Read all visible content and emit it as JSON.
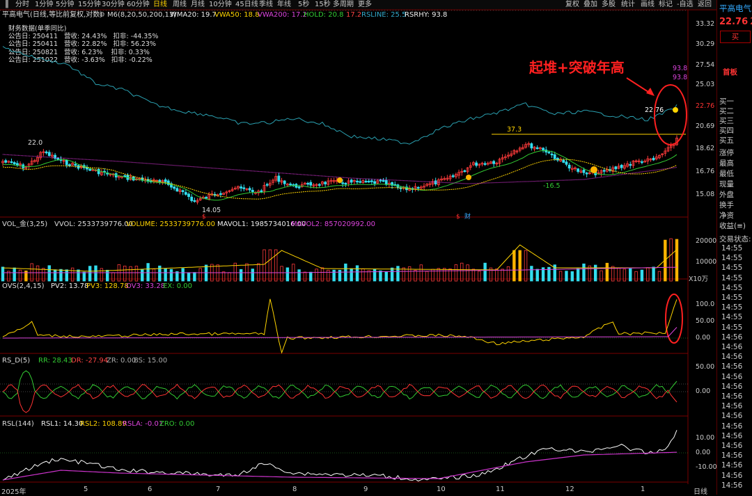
{
  "toolbar": {
    "periods": [
      "分时",
      "1分钟",
      "5分钟",
      "15分钟",
      "30分钟",
      "60分钟",
      "日线",
      "周线",
      "月线",
      "10分钟",
      "45日线",
      "季线",
      "年线",
      "5秒",
      "15秒",
      "多周期",
      "更多"
    ],
    "active": "日线",
    "actions": [
      "复权",
      "叠加",
      "多股",
      "统计",
      "画线",
      "标记",
      "-自选",
      "返回"
    ]
  },
  "header": {
    "title": "平高电气(日线,等比前复权,对数)",
    "ma": "M6(8,20,50,200,13)",
    "wma20": "WMA20: 19.7",
    "vwa50": "VWA50: 18.8",
    "vwa200": "VWA200: 17.2",
    "hold": "HOLD: 20.8",
    "hold2": "17.2",
    "rsline": "RSLINE: 25.5",
    "rsrhy": "RSRHY: 93.8"
  },
  "fin": {
    "title": "财务数据(单季同比)",
    "rows": [
      "公告日: 250411   营收: 24.43%   扣非: -44.35%",
      "公告日: 250411   营收: 22.82%   扣非: 56.23%",
      "公告日: 250821   营收: 6.23%    扣非: 0.33%",
      "公告日: 251022   营收: -3.63%   扣非: -0.22%"
    ]
  },
  "annotation": {
    "text": "起堆+突破年高",
    "color": "#ff2020"
  },
  "price_labels": {
    "high1": "22.0",
    "high2": "37.3",
    "low1": "14.05",
    "low2": "-16.5",
    "last": "22.76",
    "rs1": "93.8",
    "rs2": "93.8",
    "s1": "$",
    "s2": "$",
    "cai": "财"
  },
  "price_axis": [
    "33.32",
    "30.29",
    "27.54",
    "25.03",
    "22.76",
    "20.69",
    "18.62",
    "16.76",
    "15.08"
  ],
  "vol": {
    "label": "VOL_金(3,25)",
    "vvol": "VVOL: 2533739776.00",
    "volume": "VOLUME: 2533739776.00",
    "mavol1": "MAVOL1: 1985734016.00",
    "mavol2": "MAVOL2: 857020992.00",
    "axis": [
      "20000",
      "10000"
    ],
    "unit": "X10万"
  },
  "ovs": {
    "label": "OVS(2,4,15)",
    "pv2": "PV2: 13.78",
    "pv3": "PV3: 128.78",
    "ov3": "OV3: 33.28",
    "ex": "EX: 0.00",
    "axis": [
      "100.0",
      "50.00",
      "0.00"
    ]
  },
  "rsd": {
    "label": "RS_D(5)",
    "rr": "RR: 28.43",
    "dr": "DR: -27.94",
    "zr": "ZR: 0.00",
    "bs": "BS: 15.00",
    "axis": [
      "50.00",
      "0.00"
    ]
  },
  "rsl": {
    "label": "RSL(144)",
    "rsl1": "RSL1: 14.30",
    "rsl2": "RSL2: 108.89",
    "rsla": "RSLA: -0.01",
    "zro": "ZRO: 0.00",
    "axis": [
      "10.00",
      "0.00",
      "-10.00"
    ]
  },
  "bottom": {
    "months": [
      "2025年",
      "5",
      "6",
      "7",
      "8",
      "9",
      "10",
      "11",
      "12",
      "1"
    ],
    "period": "日线"
  },
  "side": {
    "name": "平高电气",
    "price": "22.76",
    "price2": "2",
    "buy_button": "买",
    "board": "首板",
    "book": [
      "买一",
      "买二",
      "买三",
      "买四",
      "买五"
    ],
    "fields": [
      "涨停",
      "最高",
      "最低",
      "现量",
      "外盘"
    ],
    "fields2": [
      "换手",
      "净资",
      "收益(≡)"
    ],
    "status": "交易状态:",
    "times": [
      "14:55",
      "14:55",
      "14:55",
      "14:55",
      "14:55",
      "14:55",
      "14:55",
      "14:55",
      "14:55",
      "14:56",
      "14:56",
      "14:56",
      "14:56",
      "14:56",
      "14:56",
      "14:56",
      "14:56",
      "14:56",
      "14:56",
      "14:56",
      "14:56",
      "14:56",
      "14:56",
      "14:56",
      "14:56"
    ]
  },
  "colors": {
    "up": "#ff3b3b",
    "down": "#33ddee",
    "ma_white": "#ffffff",
    "ma_yellow": "#ffd400",
    "ma_green": "#33cc33",
    "ma_magenta": "#cc33cc",
    "rsline": "#2aa0b0",
    "gold": "#ffb400"
  }
}
